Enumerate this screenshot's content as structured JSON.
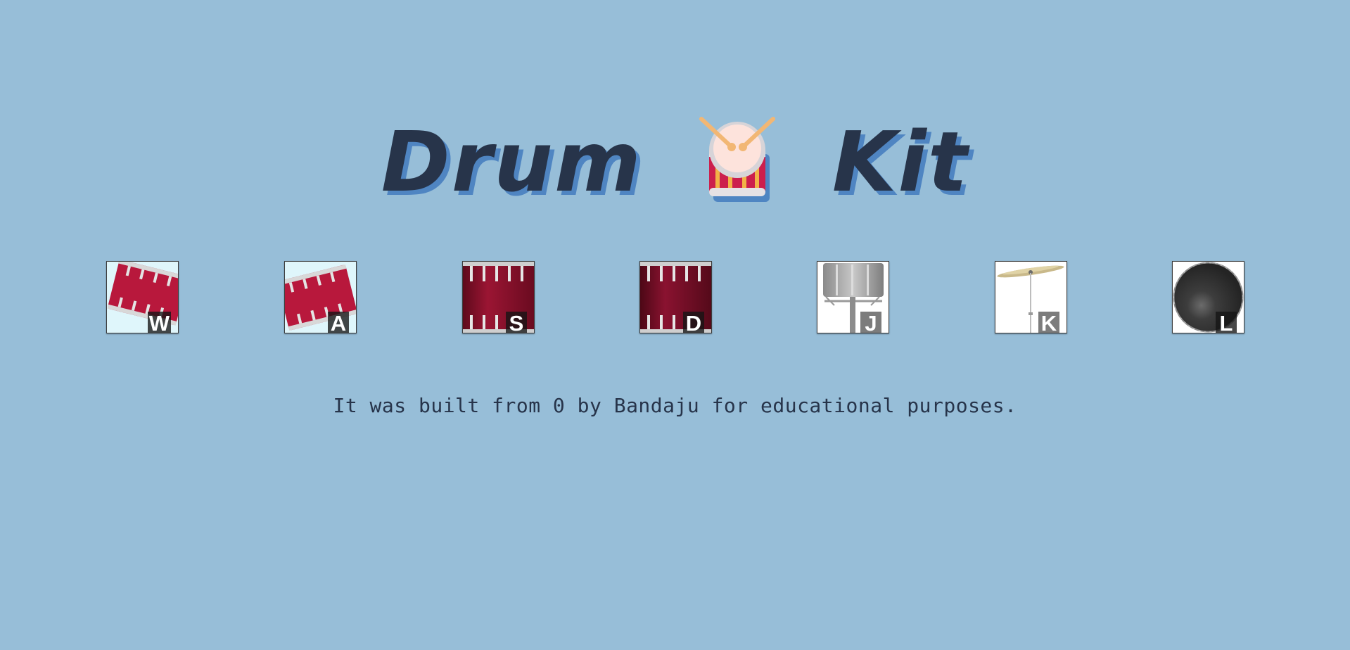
{
  "title": {
    "word_left": "Drum",
    "word_right": "Kit",
    "emoji_icon": "drum-with-drumsticks-icon",
    "color": "#27344a",
    "shadow_color": "#4f85c2"
  },
  "pads": [
    {
      "key": "W",
      "icon": "tom-drum-icon"
    },
    {
      "key": "A",
      "icon": "tom-drum-icon"
    },
    {
      "key": "S",
      "icon": "snare-drum-icon"
    },
    {
      "key": "D",
      "icon": "snare-drum-icon"
    },
    {
      "key": "J",
      "icon": "hi-hat-icon"
    },
    {
      "key": "K",
      "icon": "crash-cymbal-icon"
    },
    {
      "key": "L",
      "icon": "kick-drum-icon"
    }
  ],
  "footer": {
    "text": "It was built from 0 by Bandaju for educational purposes."
  },
  "colors": {
    "background": "#97bed8",
    "drum_red": "#b3163a",
    "drum_dark_red": "#7a0f25"
  }
}
